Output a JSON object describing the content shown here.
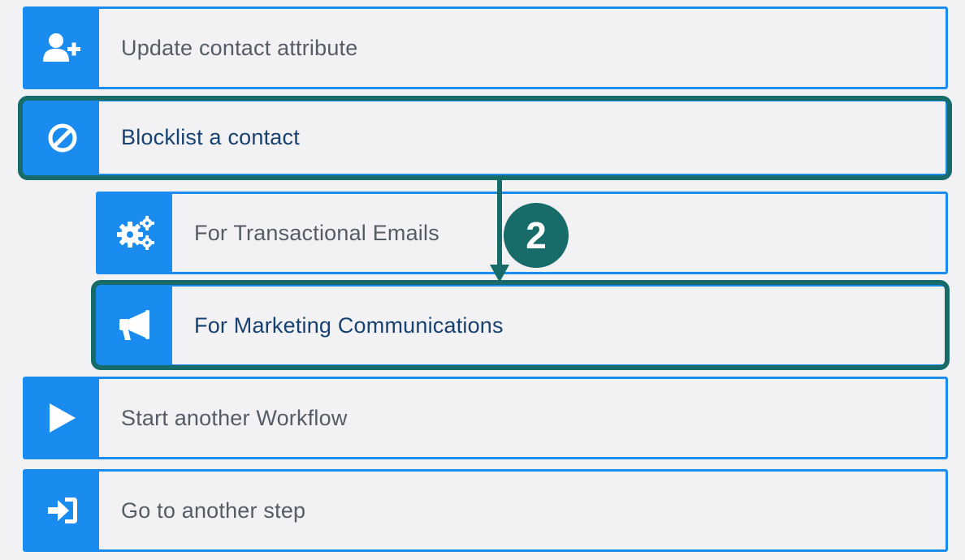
{
  "colors": {
    "accent": "#1a8cf0",
    "highlight": "#176b69",
    "label_text": "#555c66",
    "active_text": "#17416e",
    "background": "#f2f2f5"
  },
  "items": [
    {
      "label": "Update contact attribute",
      "icon": "add-user-icon"
    },
    {
      "label": "Blocklist a contact",
      "icon": "block-icon",
      "highlighted": true
    },
    {
      "label": "For Transactional Emails",
      "icon": "gears-icon",
      "indent": 1
    },
    {
      "label": "For Marketing Communications",
      "icon": "megaphone-icon",
      "indent": 1,
      "highlighted": true
    },
    {
      "label": "Start another Workflow",
      "icon": "play-icon"
    },
    {
      "label": "Go to another step",
      "icon": "sign-in-icon"
    }
  ],
  "annotation": {
    "step_number": "2"
  }
}
